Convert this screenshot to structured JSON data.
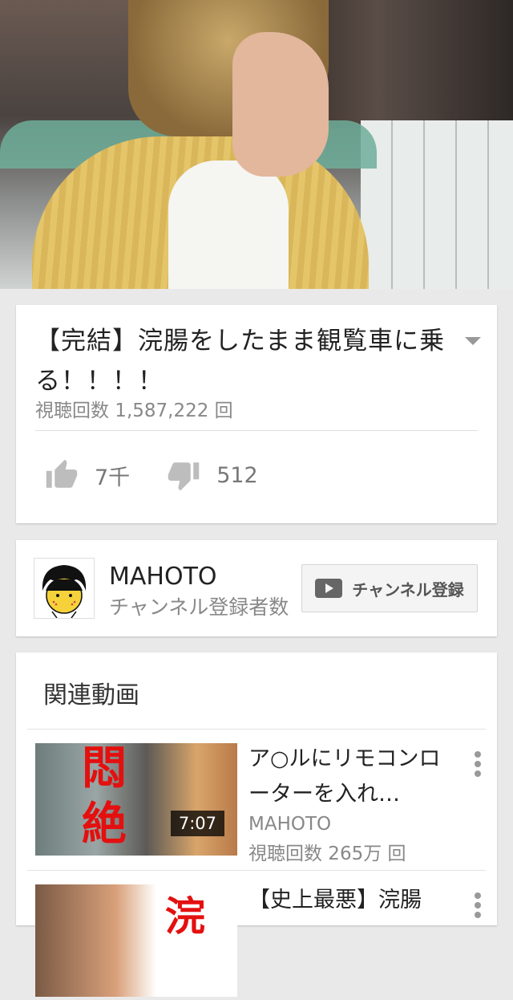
{
  "video": {
    "title": "【完結】浣腸をしたまま観覧車に乗る！！！！",
    "views": "視聴回数 1,587,222 回",
    "likes": "7千",
    "dislikes": "512"
  },
  "channel": {
    "name": "MAHOTO",
    "subscriber_label": "チャンネル登録者数",
    "subscribe_button": "チャンネル登録"
  },
  "related": {
    "heading": "関連動画",
    "items": [
      {
        "title": "ア○ルにリモコンローターを入れ…",
        "channel": "MAHOTO",
        "views": "視聴回数 265万 回",
        "duration": "7:07",
        "thumb_text": [
          "悶",
          "絶"
        ]
      },
      {
        "title": "【史上最悪】浣腸",
        "thumb_text": [
          "浣"
        ]
      }
    ]
  },
  "colors": {
    "accent_red": "#e3100f",
    "muted_text": "#888888"
  }
}
